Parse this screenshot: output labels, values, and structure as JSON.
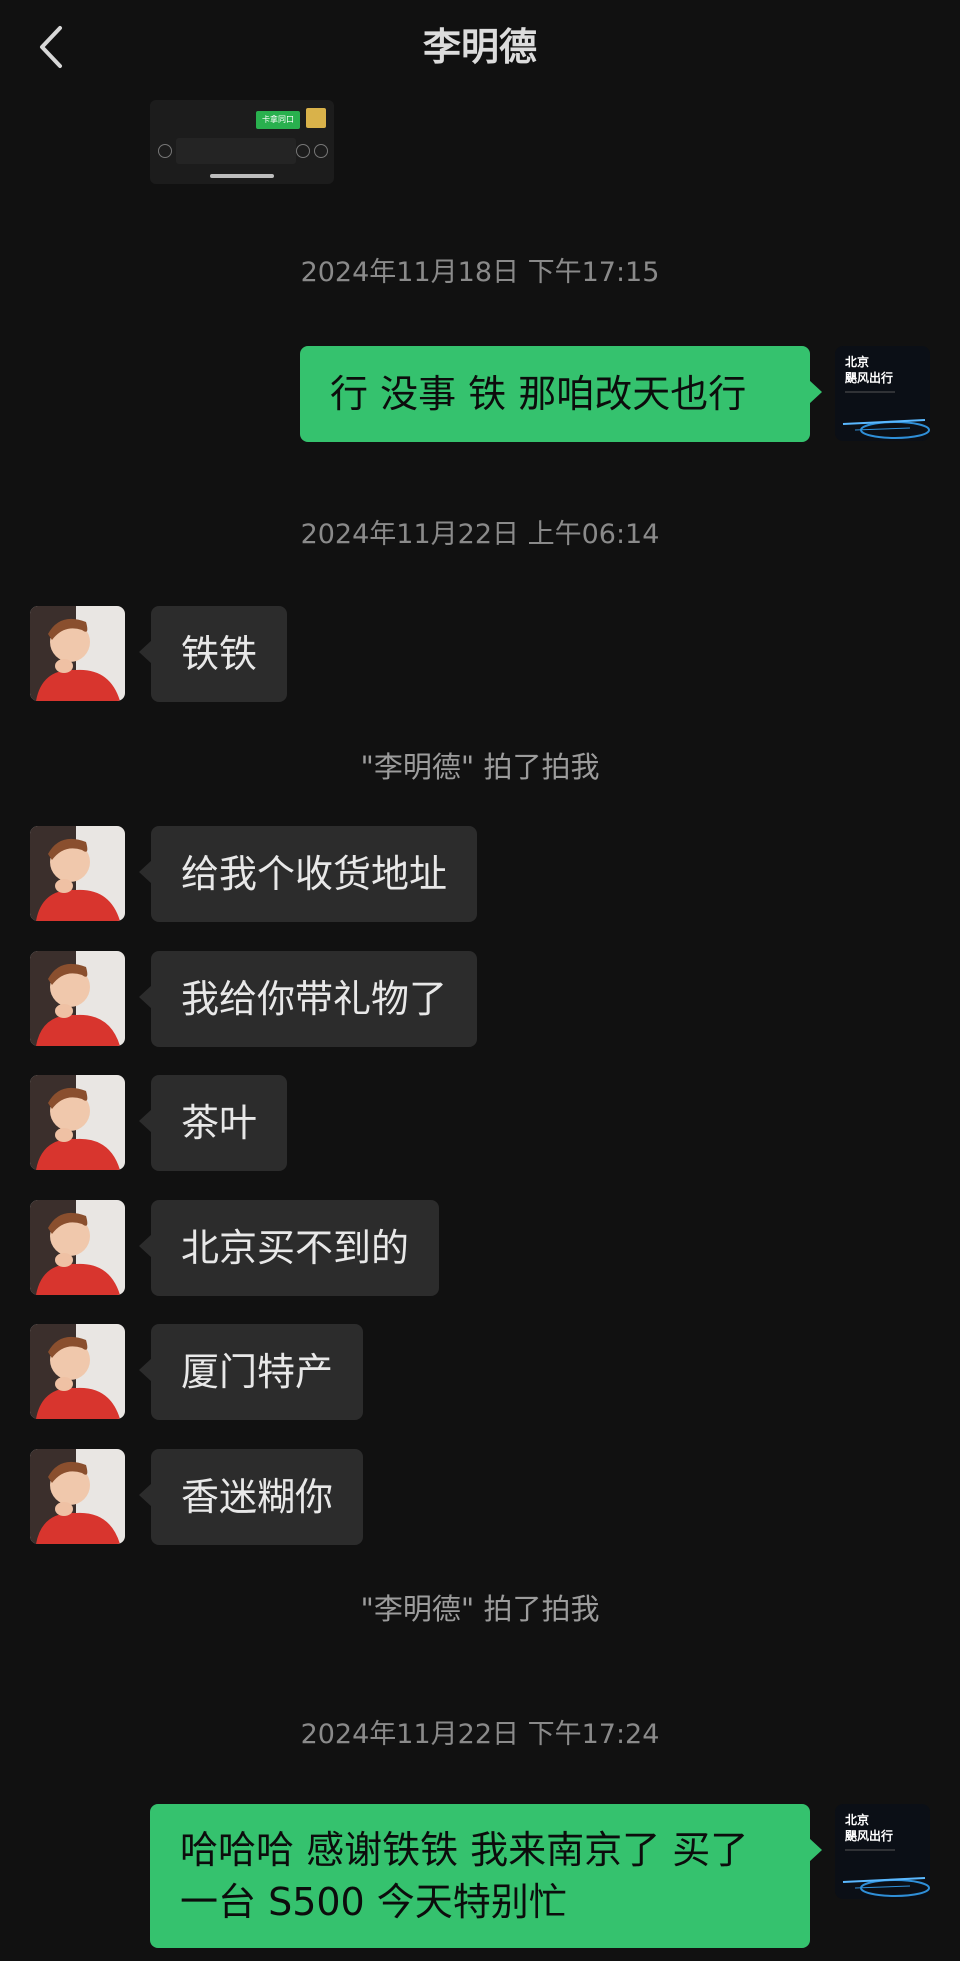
{
  "header": {
    "title": "李明德"
  },
  "thumbnail": {
    "label": "卡拿同口"
  },
  "timestamps": [
    "2024年11月18日 下午17:15",
    "2024年11月22日 上午06:14",
    "2024年11月22日 下午17:24"
  ],
  "outgoing": [
    {
      "text": "行 没事 铁 那咱改天也行"
    },
    {
      "lines": [
        "哈哈哈 感谢铁铁 我来南京了 买了",
        "一台 S500 今天特别忙"
      ]
    }
  ],
  "my_avatar": {
    "line1": "北京",
    "line2": "颶风出行"
  },
  "incoming": [
    {
      "text": "铁铁"
    },
    {
      "text": "给我个收货地址"
    },
    {
      "text": "我给你带礼物了"
    },
    {
      "text": "茶叶"
    },
    {
      "text": "北京买不到的"
    },
    {
      "text": "厦门特产"
    },
    {
      "text": "香迷糊你"
    }
  ],
  "system": [
    "\"李明德\" 拍了拍我",
    "\"李明德\" 拍了拍我"
  ],
  "colors": {
    "bg": "#111111",
    "incoming": "#2c2c2c",
    "outgoing": "#35c26e"
  }
}
